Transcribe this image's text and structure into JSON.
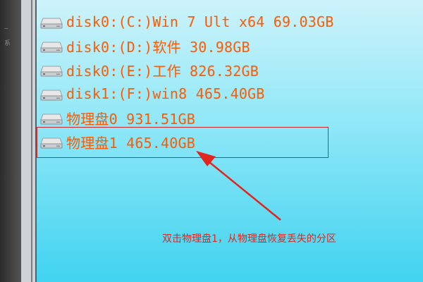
{
  "window": {
    "left_strip_fragments": [
      "",
      "—",
      "系"
    ]
  },
  "drives": [
    {
      "label": "disk0:(C:)Win 7 Ult x64 69.03GB",
      "icon": "hard-drive-icon"
    },
    {
      "label": "disk0:(D:)软件 30.98GB",
      "icon": "hard-drive-icon"
    },
    {
      "label": "disk0:(E:)工作 826.32GB",
      "icon": "hard-drive-icon"
    },
    {
      "label": "disk1:(F:)win8 465.40GB",
      "icon": "hard-drive-icon"
    },
    {
      "label": "物理盘0 931.51GB",
      "icon": "hard-drive-icon"
    },
    {
      "label": "物理盘1 465.40GB",
      "icon": "hard-drive-icon"
    }
  ],
  "annotation": {
    "text": "双击物理盘1，从物理盘恢复丢失的分区"
  },
  "colors": {
    "drive_text": "#ff5a00",
    "annotation": "#e0261f",
    "highlight_box": "#d5262b",
    "panel_top": "#cdf3fb",
    "panel_bottom": "#41d3f0"
  }
}
